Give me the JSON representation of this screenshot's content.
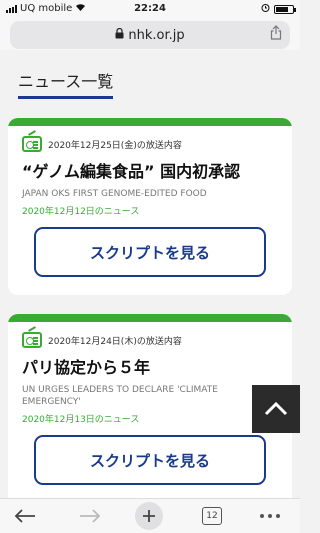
{
  "status_bar": {
    "carrier": "UQ mobile",
    "time": "22:24",
    "battery_level": 0.75
  },
  "address_bar": {
    "url": "nhk.or.jp"
  },
  "page": {
    "title": "ニュース一覧"
  },
  "cards": [
    {
      "broadcast_label": "2020年12月25日(金)の放送内容",
      "headline": "“ゲノム編集食品” 国内初承認",
      "headline_en": "JAPAN OKS FIRST GENOME-EDITED FOOD",
      "news_date": "2020年12月12日のニュース",
      "button_label": "スクリプトを見る"
    },
    {
      "broadcast_label": "2020年12月24日(木)の放送内容",
      "headline": "パリ協定から５年",
      "headline_en": "UN URGES LEADERS TO DECLARE 'CLIMATE EMERGENCY'",
      "news_date": "2020年12月13日のニュース",
      "button_label": "スクリプトを見る"
    }
  ],
  "toolbar": {
    "tab_count": "12"
  },
  "colors": {
    "accent_green": "#3aaa35",
    "accent_navy": "#1a3b8a"
  }
}
